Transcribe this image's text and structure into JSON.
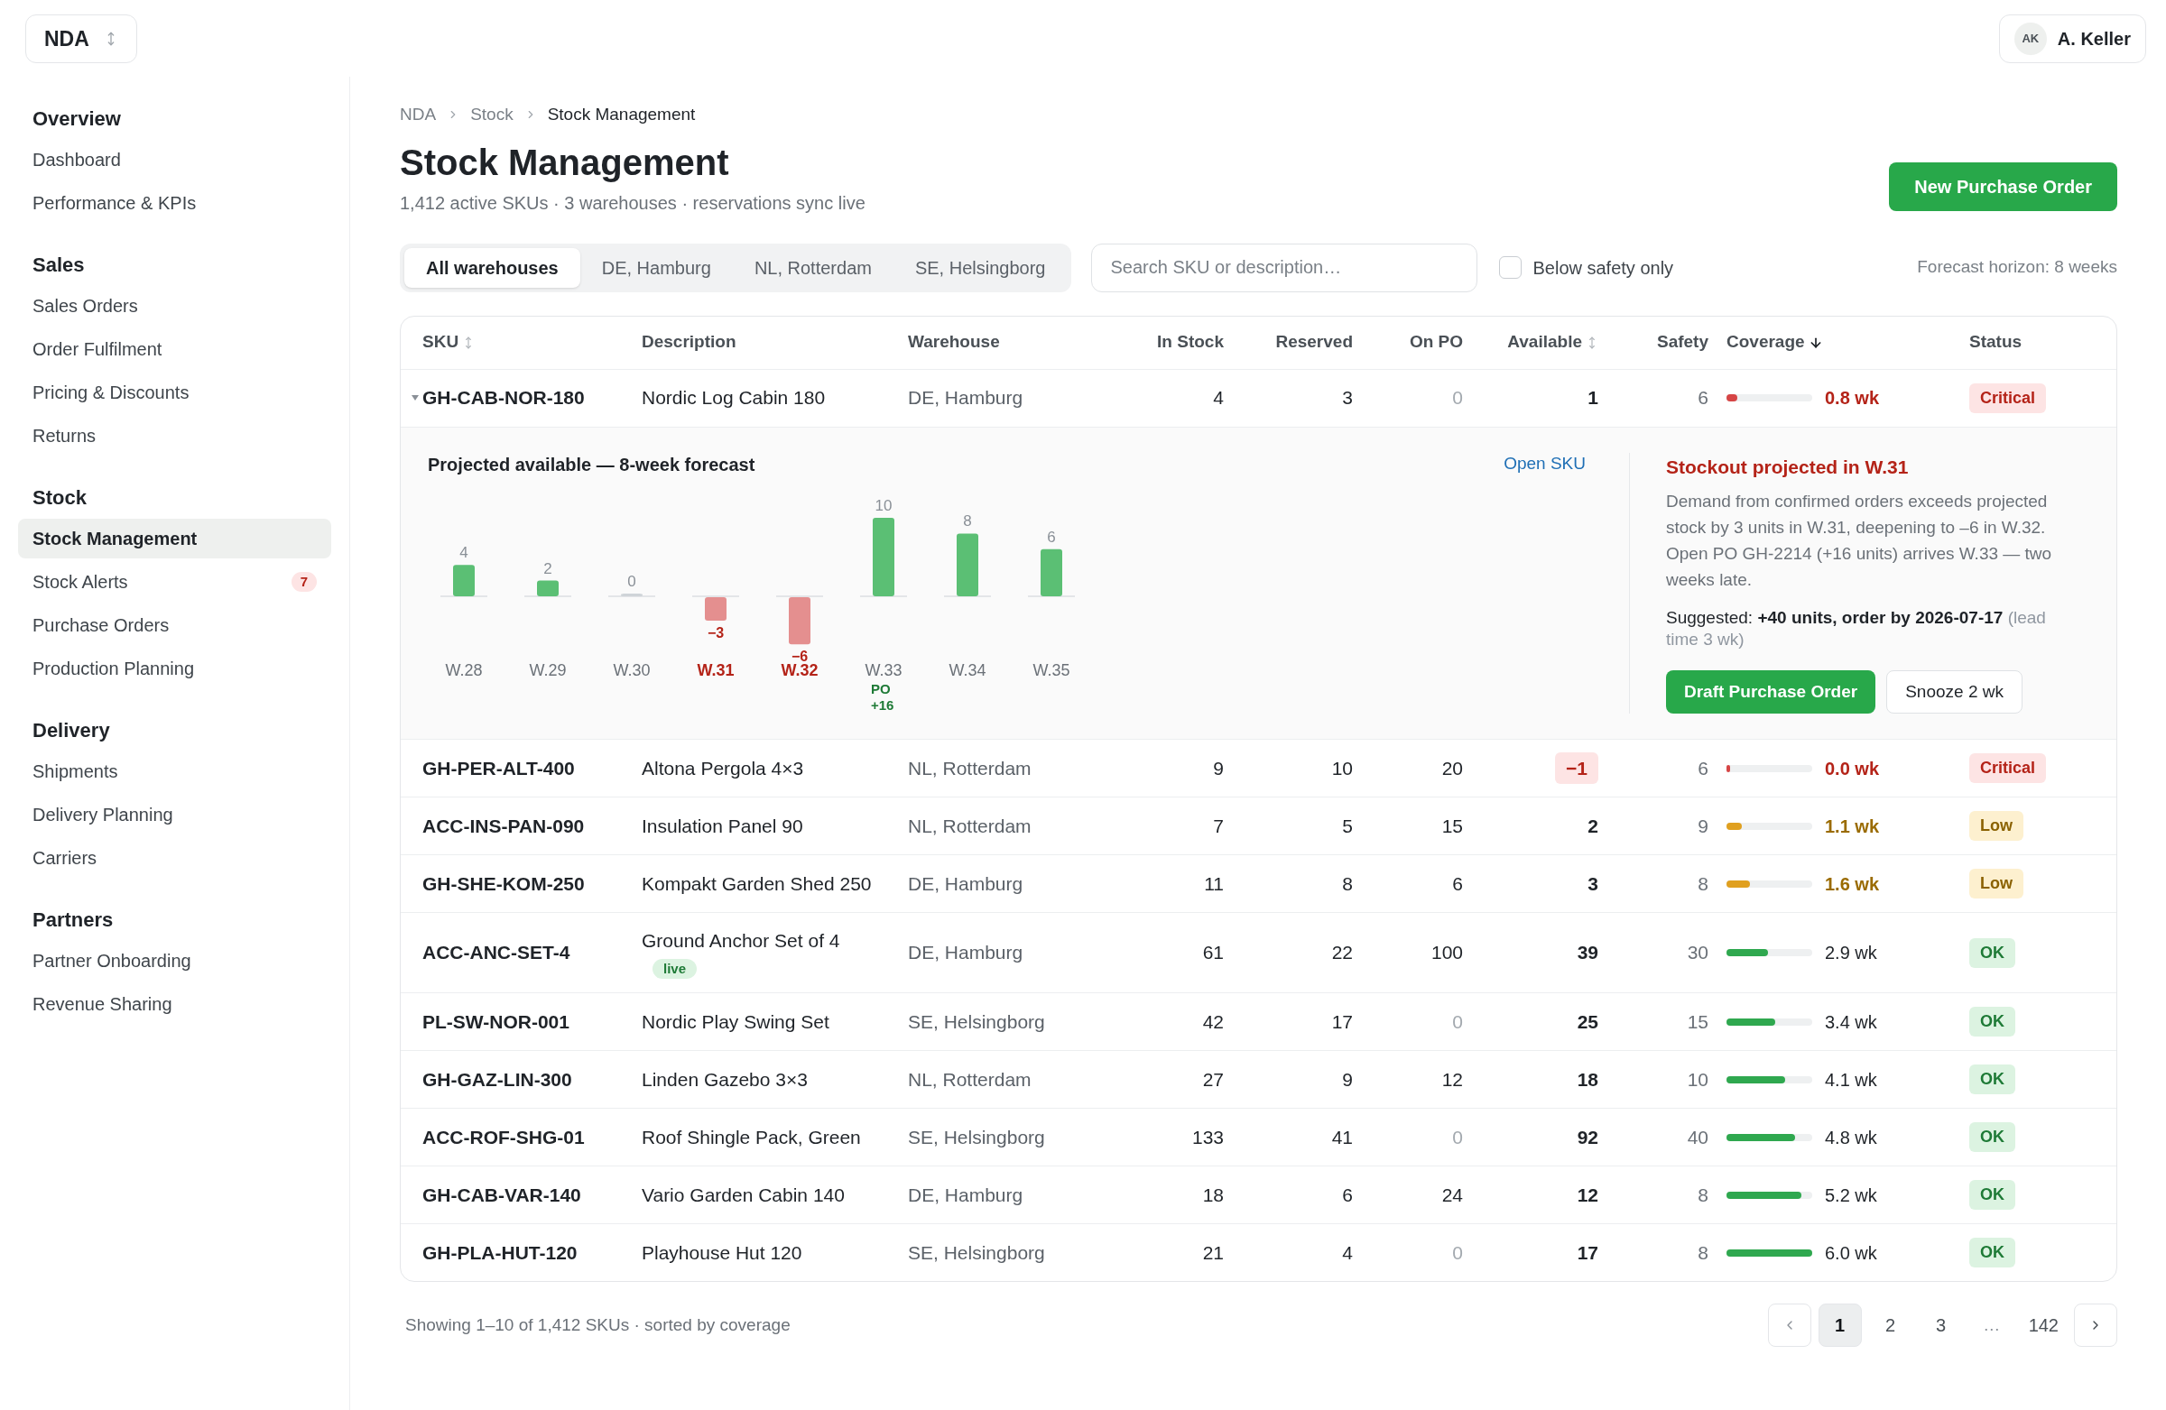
{
  "workspace": {
    "label": "NDA"
  },
  "user": {
    "initials": "AK",
    "name": "A. Keller"
  },
  "sidebar": {
    "groups": [
      {
        "heading": "Overview",
        "items": [
          {
            "label": "Dashboard",
            "selected": false
          },
          {
            "label": "Performance & KPIs",
            "selected": false
          }
        ]
      },
      {
        "heading": "Sales",
        "items": [
          {
            "label": "Sales Orders",
            "selected": false
          },
          {
            "label": "Order Fulfilment",
            "selected": false
          },
          {
            "label": "Pricing & Discounts",
            "selected": false
          },
          {
            "label": "Returns",
            "selected": false
          }
        ]
      },
      {
        "heading": "Stock",
        "items": [
          {
            "label": "Stock Management",
            "selected": true
          },
          {
            "label": "Stock Alerts",
            "selected": false,
            "badge": "7"
          },
          {
            "label": "Purchase Orders",
            "selected": false
          },
          {
            "label": "Production Planning",
            "selected": false
          }
        ]
      },
      {
        "heading": "Delivery",
        "items": [
          {
            "label": "Shipments",
            "selected": false
          },
          {
            "label": "Delivery Planning",
            "selected": false
          },
          {
            "label": "Carriers",
            "selected": false
          }
        ]
      },
      {
        "heading": "Partners",
        "items": [
          {
            "label": "Partner Onboarding",
            "selected": false
          },
          {
            "label": "Revenue Sharing",
            "selected": false
          }
        ]
      }
    ]
  },
  "breadcrumb": [
    "NDA",
    "Stock",
    "Stock Management"
  ],
  "page": {
    "title": "Stock Management",
    "subtitle": "1,412 active SKUs · 3 warehouses · reservations sync live"
  },
  "primary_action": "New Purchase Order",
  "warehouse_tabs": [
    {
      "label": "All warehouses",
      "selected": true
    },
    {
      "label": "DE, Hamburg",
      "selected": false
    },
    {
      "label": "NL, Rotterdam",
      "selected": false
    },
    {
      "label": "SE, Helsingborg",
      "selected": false
    }
  ],
  "search": {
    "placeholder": "Search SKU or description…"
  },
  "filter_checkbox": {
    "label": "Below safety only",
    "checked": false
  },
  "forecast_horizon": "Forecast horizon: 8 weeks",
  "table": {
    "columns": [
      {
        "label": "SKU",
        "sorted": false
      },
      {
        "label": "Description"
      },
      {
        "label": "Warehouse"
      },
      {
        "label": "In Stock"
      },
      {
        "label": "Reserved"
      },
      {
        "label": "On PO"
      },
      {
        "label": "Available",
        "sorted": false
      },
      {
        "label": "Safety"
      },
      {
        "label": "Coverage",
        "sorted": true
      },
      {
        "label": "Status"
      }
    ],
    "rows": [
      {
        "sku": "GH-CAB-NOR-180",
        "description": "Nordic Log Cabin 180",
        "warehouse": "DE, Hamburg",
        "in_stock": "4",
        "reserved": "3",
        "on_po": "0",
        "available": "1",
        "available_alert": false,
        "safety": "6",
        "coverage": {
          "level": 0.13,
          "reading": "0.8 wk"
        },
        "status": {
          "kind": "critical",
          "label": "Critical"
        },
        "expanded": true,
        "detail": {
          "chart_data": {
            "type": "bar",
            "title": "Projected available — 8-week forecast",
            "categories": [
              "W.28",
              "W.29",
              "W.30",
              "W.31",
              "W.32",
              "W.33",
              "W.34",
              "W.35"
            ],
            "values": [
              4,
              2,
              0,
              -3,
              -6,
              10,
              8,
              6
            ],
            "data_labels": true,
            "annotations": [
              "PO +16"
            ]
          },
          "link": "Open SKU",
          "alert": {
            "title": "Stockout projected in W.31",
            "body": "Demand from confirmed orders exceeds projected stock by 3 units in W.31, deepening to –6 in W.32. Open PO GH-2214 (+16 units) arrives W.33 — two weeks late.",
            "suggestion": "Suggested: **+40 units, order by 2026-07-17**",
            "note": "(lead time 3 wk)"
          },
          "actions": [
            {
              "label": "Draft Purchase Order",
              "kind": "primary"
            },
            {
              "label": "Snooze 2 wk",
              "kind": "secondary"
            }
          ]
        }
      },
      {
        "sku": "GH-PER-ALT-400",
        "description": "Altona Pergola 4×3",
        "warehouse": "NL, Rotterdam",
        "in_stock": "9",
        "reserved": "10",
        "on_po": "20",
        "available": "−1",
        "available_alert": true,
        "safety": "6",
        "coverage": {
          "level": 0.02,
          "reading": "0.0 wk"
        },
        "status": {
          "kind": "critical",
          "label": "Critical"
        },
        "expanded": false
      },
      {
        "sku": "ACC-INS-PAN-090",
        "description": "Insulation Panel 90",
        "warehouse": "NL, Rotterdam",
        "in_stock": "7",
        "reserved": "5",
        "on_po": "15",
        "available": "2",
        "available_alert": false,
        "safety": "9",
        "coverage": {
          "level": 0.18,
          "reading": "1.1 wk"
        },
        "status": {
          "kind": "low",
          "label": "Low"
        },
        "expanded": false
      },
      {
        "sku": "GH-SHE-KOM-250",
        "description": "Kompakt Garden Shed 250",
        "warehouse": "DE, Hamburg",
        "in_stock": "11",
        "reserved": "8",
        "on_po": "6",
        "available": "3",
        "available_alert": false,
        "safety": "8",
        "coverage": {
          "level": 0.27,
          "reading": "1.6 wk"
        },
        "status": {
          "kind": "low",
          "label": "Low"
        },
        "expanded": false
      },
      {
        "sku": "ACC-ANC-SET-4",
        "description": "Ground Anchor Set of 4",
        "tag": "live",
        "warehouse": "DE, Hamburg",
        "in_stock": "61",
        "reserved": "22",
        "on_po": "100",
        "available": "39",
        "available_alert": false,
        "safety": "30",
        "coverage": {
          "level": 0.48,
          "reading": "2.9 wk"
        },
        "status": {
          "kind": "ok",
          "label": "OK"
        },
        "expanded": false
      },
      {
        "sku": "PL-SW-NOR-001",
        "description": "Nordic Play Swing Set",
        "warehouse": "SE, Helsingborg",
        "in_stock": "42",
        "reserved": "17",
        "on_po": "0",
        "available": "25",
        "available_alert": false,
        "safety": "15",
        "coverage": {
          "level": 0.57,
          "reading": "3.4 wk"
        },
        "status": {
          "kind": "ok",
          "label": "OK"
        },
        "expanded": false
      },
      {
        "sku": "GH-GAZ-LIN-300",
        "description": "Linden Gazebo 3×3",
        "warehouse": "NL, Rotterdam",
        "in_stock": "27",
        "reserved": "9",
        "on_po": "12",
        "available": "18",
        "available_alert": false,
        "safety": "10",
        "coverage": {
          "level": 0.68,
          "reading": "4.1 wk"
        },
        "status": {
          "kind": "ok",
          "label": "OK"
        },
        "expanded": false
      },
      {
        "sku": "ACC-ROF-SHG-01",
        "description": "Roof Shingle Pack, Green",
        "warehouse": "SE, Helsingborg",
        "in_stock": "133",
        "reserved": "41",
        "on_po": "0",
        "available": "92",
        "available_alert": false,
        "safety": "40",
        "coverage": {
          "level": 0.8,
          "reading": "4.8 wk"
        },
        "status": {
          "kind": "ok",
          "label": "OK"
        },
        "expanded": false
      },
      {
        "sku": "GH-CAB-VAR-140",
        "description": "Vario Garden Cabin 140",
        "warehouse": "DE, Hamburg",
        "in_stock": "18",
        "reserved": "6",
        "on_po": "24",
        "available": "12",
        "available_alert": false,
        "safety": "8",
        "coverage": {
          "level": 0.87,
          "reading": "5.2 wk"
        },
        "status": {
          "kind": "ok",
          "label": "OK"
        },
        "expanded": false
      },
      {
        "sku": "GH-PLA-HUT-120",
        "description": "Playhouse Hut 120",
        "warehouse": "SE, Helsingborg",
        "in_stock": "21",
        "reserved": "4",
        "on_po": "0",
        "available": "17",
        "available_alert": false,
        "safety": "8",
        "coverage": {
          "level": 1,
          "reading": "6.0 wk"
        },
        "status": {
          "kind": "ok",
          "label": "OK"
        },
        "expanded": false
      }
    ]
  },
  "footer": {
    "summary": "Showing 1–10 of 1,412 SKUs · sorted by coverage"
  },
  "pagination": {
    "pages": [
      {
        "label": "1",
        "kind": "page",
        "selected": true
      },
      {
        "label": "2",
        "kind": "page",
        "selected": false
      },
      {
        "label": "3",
        "kind": "page",
        "selected": false
      },
      {
        "label": "…",
        "kind": "gap"
      },
      {
        "label": "142",
        "kind": "page",
        "selected": false
      }
    ]
  }
}
